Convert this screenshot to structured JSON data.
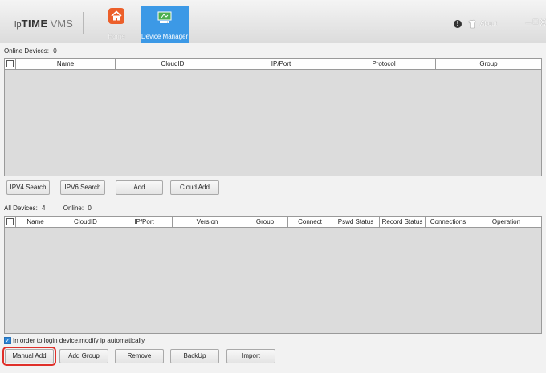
{
  "app": {
    "logo_ip": "ip",
    "logo_time": "TIME",
    "logo_vms": "VMS",
    "nav": {
      "home_label": "Home",
      "device_manager_label": "Device Manager"
    },
    "about_label": "About",
    "win_min": "–",
    "win_max": "□",
    "win_close": "X"
  },
  "online": {
    "title": "Online Devices:",
    "count": "0",
    "columns": [
      "Name",
      "CloudID",
      "IP/Port",
      "Protocol",
      "Group"
    ],
    "rows": []
  },
  "online_buttons": {
    "ipv4_search": "IPV4 Search",
    "ipv6_search": "IPV6 Search",
    "add": "Add",
    "cloud_add": "Cloud Add"
  },
  "all": {
    "title": "All Devices:",
    "count": "4",
    "online_label": "Online:",
    "online_count": "0",
    "columns": [
      "Name",
      "CloudID",
      "IP/Port",
      "Version",
      "Group",
      "Connect",
      "Pswd Status",
      "Record Status",
      "Connections",
      "Operation"
    ],
    "rows": []
  },
  "auto_ip": {
    "checked": true,
    "label": "In order to login device,modify ip automatically"
  },
  "bottom_buttons": {
    "manual_add": "Manual Add",
    "add_group": "Add Group",
    "remove": "Remove",
    "backup": "BackUp",
    "import": "Import"
  },
  "colors": {
    "accent": "#3c99e6",
    "home_icon": "#ec5f2a",
    "highlight": "#e0302a"
  },
  "icons": {
    "home": "home-icon",
    "device_manager": "device-manager-icon",
    "info": "info-icon",
    "shirt": "shirt-icon"
  }
}
